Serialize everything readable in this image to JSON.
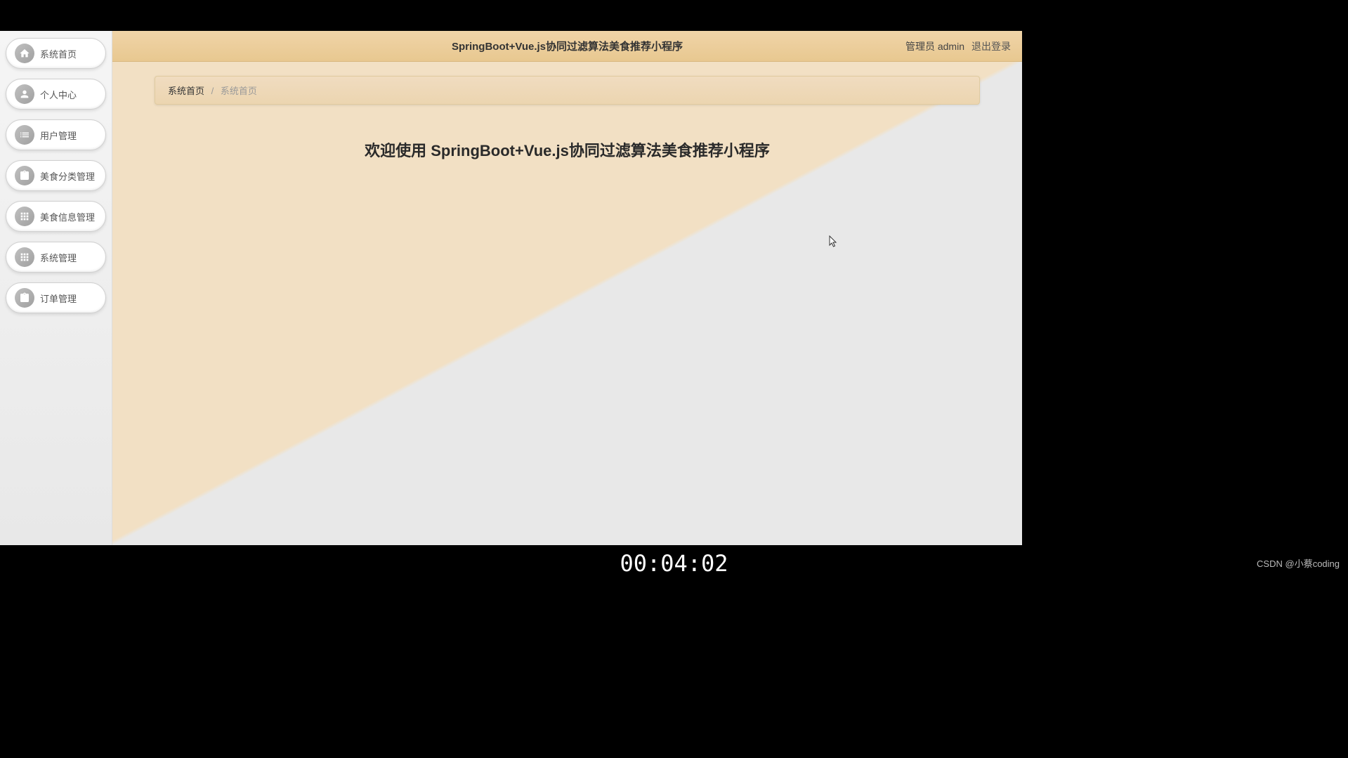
{
  "header": {
    "title": "SpringBoot+Vue.js协同过滤算法美食推荐小程序",
    "user_role": "管理员",
    "user_name": "admin",
    "logout": "退出登录"
  },
  "sidebar": {
    "items": [
      {
        "label": "系统首页",
        "icon": "home"
      },
      {
        "label": "个人中心",
        "icon": "user"
      },
      {
        "label": "用户管理",
        "icon": "list"
      },
      {
        "label": "美食分类管理",
        "icon": "clipboard"
      },
      {
        "label": "美食信息管理",
        "icon": "grid"
      },
      {
        "label": "系统管理",
        "icon": "grid"
      },
      {
        "label": "订单管理",
        "icon": "clipboard"
      }
    ]
  },
  "breadcrumb": {
    "root": "系统首页",
    "current": "系统首页"
  },
  "main": {
    "welcome": "欢迎使用 SpringBoot+Vue.js协同过滤算法美食推荐小程序"
  },
  "timestamp": "00:04:02",
  "watermark": "CSDN @小蔡coding"
}
